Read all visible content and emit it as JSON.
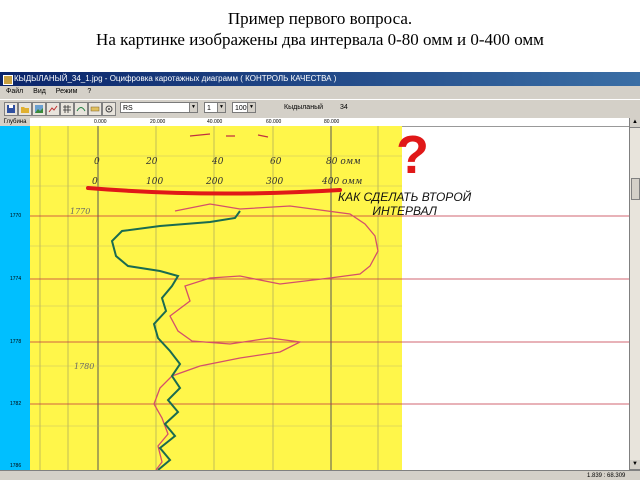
{
  "slide": {
    "title_line1": "Пример первого вопроса.",
    "title_line2": "На картинке изображены два интервала 0-80 омм и 0-400 омм"
  },
  "window": {
    "title": "КЫДЫЛАНЫЙ_34_1.jpg - Оцифровка каротажных диаграмм ( КОНТРОЛЬ КАЧЕСТВА )"
  },
  "menu": [
    "Файл",
    "Вид",
    "Режим",
    "?"
  ],
  "toolbar": {
    "curve_name": "RS",
    "step": "1",
    "zoom": "100%",
    "well_name": "Кыдыланый",
    "well_number": "34"
  },
  "depth_column": {
    "header": "Глубина",
    "ticks": [
      "1770",
      "1774",
      "1778",
      "1782",
      "1786"
    ]
  },
  "scale_row": {
    "labels": [
      "0.000",
      "20.000",
      "40.000",
      "60.000",
      "80.000"
    ]
  },
  "handwritten_scale": {
    "row1": [
      "0",
      "20",
      "40",
      "60",
      "80 омм"
    ],
    "row2": [
      "0",
      "100",
      "200",
      "300",
      "400 омм"
    ]
  },
  "log_depth_labels": [
    "1770",
    "1780"
  ],
  "annotation": {
    "question_mark": "?",
    "line1": "КАК СДЕЛАТЬ ВТОРОЙ",
    "line2": "ИНТЕРВАЛ"
  },
  "statusbar": {
    "coords": "1.839 : 68.309"
  },
  "colors": {
    "depth_track": "#00bfff",
    "yellow_panel": "#fff64a",
    "red_curve": "#d4506a",
    "green_curve": "#1a6b50",
    "annotation_red": "#e01818",
    "depth_lines": "#c03040"
  }
}
